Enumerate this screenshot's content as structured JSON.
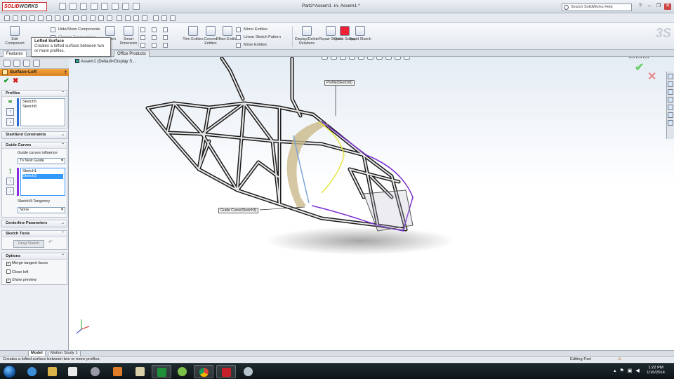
{
  "app": {
    "logo_brand": "SOLID",
    "logo_suffix": "WORKS",
    "window_title": "Part2^Assem1 -in- Assem1 *",
    "help_search_placeholder": "Search SolidWorks Help"
  },
  "ribbon": {
    "edit_component": "Edit Component",
    "hide_show_components": "Hide/Show Components",
    "change_transparency": "Change Transparency",
    "sketch": "Sketch",
    "smart_dimension": "Smart Dimension",
    "trim_entities": "Trim Entities",
    "convert_entities": "Convert Entities",
    "offset_entities": "Offset Entities",
    "mirror_entities": "Mirror Entities",
    "linear_sketch_pattern": "Linear Sketch Pattern",
    "move_entities": "Move Entities",
    "display_delete_relations": "Display/Delete Relations",
    "repair_sketch": "Repair Sketch",
    "quick_snaps": "Quick Snaps",
    "rapid_sketch": "Rapid Sketch"
  },
  "tabs": {
    "features": "Features",
    "office_products": "Office Products"
  },
  "tooltip": {
    "title": "Lofted Surface",
    "text": "Creates a lofted surface between two or more profiles."
  },
  "property_manager": {
    "title": "Surface-Loft",
    "help": "?",
    "profiles": {
      "header": "Profiles",
      "items": [
        "Sketch5",
        "Sketch8"
      ]
    },
    "start_end": {
      "header": "Start/End Constraints"
    },
    "guide_curves": {
      "header": "Guide Curves",
      "influence_label": "Guide curves influence",
      "influence_value": "To Next Guide",
      "items": [
        "Sketch1",
        "Sketch3"
      ],
      "tangency_label": "Sketch3-Tangency",
      "tangency_value": "None"
    },
    "centerline": {
      "header": "Centerline Parameters"
    },
    "sketch_tools": {
      "header": "Sketch Tools",
      "drag_sketch": "Drag Sketch"
    },
    "options": {
      "header": "Options",
      "merge_tangent": {
        "label": "Merge tangent faces",
        "checked": true
      },
      "close_loft": {
        "label": "Close loft",
        "checked": false
      },
      "show_preview": {
        "label": "Show preview",
        "checked": true
      }
    }
  },
  "graphics": {
    "tree_root": "Assem1 (Default<Display S...",
    "callout_profile": "Profile(Sketch8)",
    "callout_guide": "Guide Curve(Sketch3)",
    "frame_color": "#1c1c1c",
    "surface_color": "#c9b98a",
    "guide_yellow": "#e6e640",
    "guide_purple": "#7b2fd6"
  },
  "bottom_tabs": {
    "model": "Model",
    "motion_study": "Motion Study 1"
  },
  "status": {
    "message": "Creates a lofted surface between two or more profiles.",
    "mode": "Editing Part"
  },
  "taskbar": {
    "time": "1:22 PM",
    "date": "1/16/2014"
  }
}
